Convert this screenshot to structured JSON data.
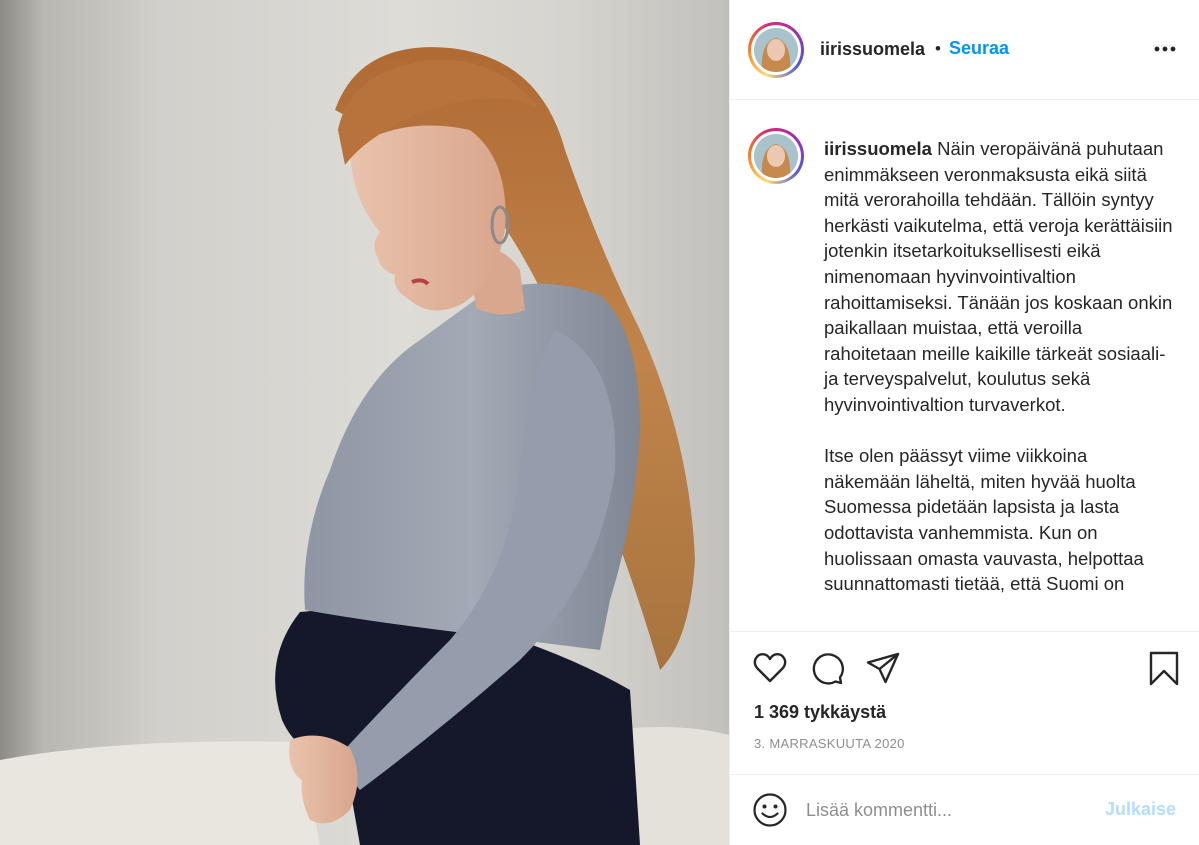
{
  "post": {
    "username": "iirissuomela",
    "follow_label": "Seuraa",
    "header_separator": "•",
    "caption_user": "iirissuomela",
    "caption_text": " Näin veropäivänä puhutaan enimmäkseen veronmaksusta eikä siitä mitä verorahoilla tehdään. Tällöin syntyy herkästi vaikutelma, että veroja kerättäisiin jotenkin itsetarkoituksellisesti eikä nimenomaan hyvinvointivaltion rahoittamiseksi. Tänään jos koskaan onkin paikallaan muistaa, että veroilla rahoitetaan meille kaikille tärkeät sosiaali- ja terveyspalvelut, koulutus sekä hyvinvointivaltion turvaverkot.\n\nItse olen päässyt viime viikkoina näkemään läheltä, miten hyvää huolta Suomessa pidetään lapsista ja lasta odottavista vanhemmista. Kun on huolissaan omasta vauvasta, helpottaa suunnattomasti tietää, että Suomi on",
    "likes": "1 369 tykkäystä",
    "date": "3. MARRASKUUTA 2020"
  },
  "comment": {
    "placeholder": "Lisää kommentti...",
    "publish_label": "Julkaise"
  },
  "icons": {
    "more": "more-options-icon",
    "like": "heart-icon",
    "comment": "comment-icon",
    "share": "share-icon",
    "save": "bookmark-icon",
    "emoji": "emoji-icon"
  },
  "colors": {
    "accent": "#0095f6",
    "publish_disabled": "#b2dffc",
    "muted": "#8e8e8e",
    "text": "#262626",
    "divider": "#efefef"
  }
}
